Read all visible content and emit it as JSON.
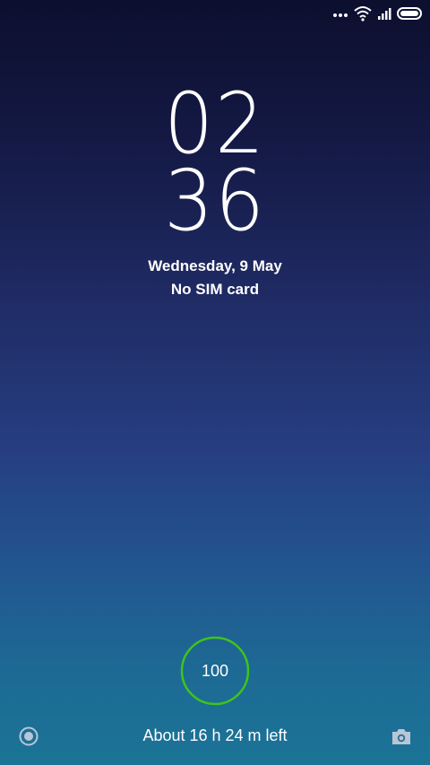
{
  "status_bar": {
    "icons": [
      "more-dots-icon",
      "wifi-icon",
      "signal-icon",
      "battery-icon"
    ]
  },
  "clock": {
    "hours": "02",
    "minutes": "36"
  },
  "date": "Wednesday, 9 May",
  "sim_status": "No SIM card",
  "battery": {
    "level": "100",
    "level_fraction": 1.0,
    "time_left": "About 16 h 24 m left",
    "ring_color": "#3ec41a"
  },
  "shortcuts": {
    "left": "record-circle-icon",
    "right": "camera-icon"
  },
  "colors": {
    "background_top": "#0c0f2e",
    "background_bottom": "#1b7496",
    "text": "#ffffff"
  }
}
